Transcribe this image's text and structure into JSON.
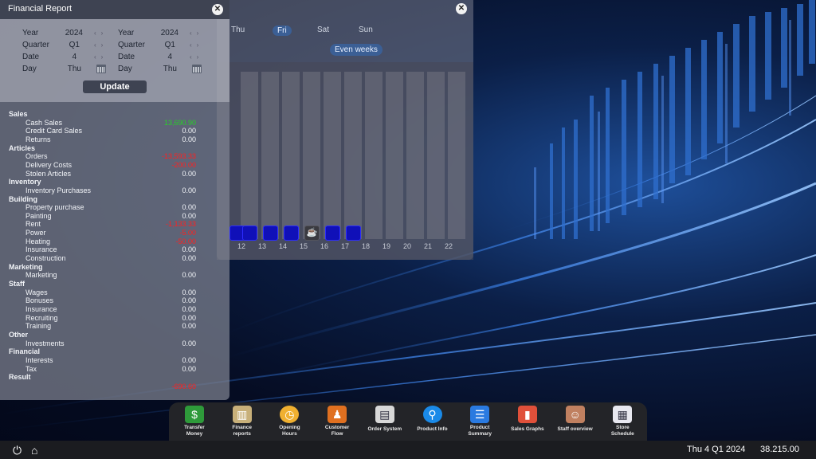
{
  "week_schedule": {
    "days": [
      "Thu",
      "Fri",
      "Sat",
      "Sun"
    ],
    "selected_day": "Fri",
    "even_weeks_label": "Even weeks",
    "close_icon": "close-icon",
    "hours": [
      "12",
      "13",
      "14",
      "15",
      "16",
      "17",
      "18",
      "19",
      "20",
      "21",
      "22"
    ]
  },
  "financial_report": {
    "title": "Financial Report",
    "close_icon": "close-icon",
    "filters_left": {
      "year_label": "Year",
      "year_value": "2024",
      "quarter_label": "Quarter",
      "quarter_value": "Q1",
      "date_label": "Date",
      "date_value": "4",
      "day_label": "Day",
      "day_value": "Thu"
    },
    "filters_right": {
      "year_label": "Year",
      "year_value": "2024",
      "quarter_label": "Quarter",
      "quarter_value": "Q1",
      "date_label": "Date",
      "date_value": "4",
      "day_label": "Day",
      "day_value": "Thu"
    },
    "update_label": "Update",
    "sections": [
      {
        "category": "Sales",
        "items": [
          {
            "label": "Cash Sales",
            "value": "13,690.90",
            "color": "green"
          },
          {
            "label": "Credit Card Sales",
            "value": "0.00",
            "color": "white"
          },
          {
            "label": "Returns",
            "value": "0.00",
            "color": "white"
          }
        ]
      },
      {
        "category": "Articles",
        "items": [
          {
            "label": "Orders",
            "value": "-13,593.33",
            "color": "red"
          },
          {
            "label": "Delivery Costs",
            "value": "-200.00",
            "color": "red"
          },
          {
            "label": "Stolen Articles",
            "value": "0.00",
            "color": "white"
          }
        ]
      },
      {
        "category": "Inventory",
        "items": [
          {
            "label": "Inventory Purchases",
            "value": "0.00",
            "color": "white"
          }
        ]
      },
      {
        "category": "Building",
        "items": [
          {
            "label": "Property purchase",
            "value": "0.00",
            "color": "white"
          },
          {
            "label": "Painting",
            "value": "0.00",
            "color": "white"
          },
          {
            "label": "Rent",
            "value": "-1,133.33",
            "color": "red"
          },
          {
            "label": "Power",
            "value": "-5.00",
            "color": "red"
          },
          {
            "label": "Heating",
            "value": "-50.00",
            "color": "red"
          },
          {
            "label": "Insurance",
            "value": "0.00",
            "color": "white"
          },
          {
            "label": "Construction",
            "value": "0.00",
            "color": "white"
          }
        ]
      },
      {
        "category": "Marketing",
        "items": [
          {
            "label": "Marketing",
            "value": "0.00",
            "color": "white"
          }
        ]
      },
      {
        "category": "Staff",
        "items": [
          {
            "label": "Wages",
            "value": "0.00",
            "color": "white"
          },
          {
            "label": "Bonuses",
            "value": "0.00",
            "color": "white"
          },
          {
            "label": "Insurance",
            "value": "0.00",
            "color": "white"
          },
          {
            "label": "Recruiting",
            "value": "0.00",
            "color": "white"
          },
          {
            "label": "Training",
            "value": "0.00",
            "color": "white"
          }
        ]
      },
      {
        "category": "Other",
        "items": [
          {
            "label": "Investments",
            "value": "0.00",
            "color": "white"
          }
        ]
      },
      {
        "category": "Financial",
        "items": [
          {
            "label": "Interests",
            "value": "0.00",
            "color": "white"
          },
          {
            "label": "Tax",
            "value": "0.00",
            "color": "white"
          }
        ]
      }
    ],
    "result_label": "Result",
    "result_value": "-690.60",
    "result_color": "red"
  },
  "dock": [
    {
      "label_1": "Transfer",
      "label_2": "Money",
      "icon": "money-transfer-icon",
      "color": "#2e9a3a"
    },
    {
      "label_1": "Finance",
      "label_2": "reports",
      "icon": "finance-chart-icon",
      "color": "#c8b07a"
    },
    {
      "label_1": "Opening",
      "label_2": "Hours",
      "icon": "clock-icon",
      "color": "#f0b030"
    },
    {
      "label_1": "Customer",
      "label_2": "Flow",
      "icon": "customer-flow-icon",
      "color": "#e07020"
    },
    {
      "label_1": "Order System",
      "label_2": "",
      "icon": "clipboard-icon",
      "color": "#d8d8d8"
    },
    {
      "label_1": "Product Info",
      "label_2": "",
      "icon": "product-search-icon",
      "color": "#1a8ae8"
    },
    {
      "label_1": "Product",
      "label_2": "Summary",
      "icon": "list-icon",
      "color": "#2a7ae0"
    },
    {
      "label_1": "Sales Graphs",
      "label_2": "",
      "icon": "bar-graph-icon",
      "color": "#e0503a"
    },
    {
      "label_1": "Staff overview",
      "label_2": "",
      "icon": "staff-icon",
      "color": "#c08060"
    },
    {
      "label_1": "Store",
      "label_2": "Schedule",
      "icon": "calendar-icon",
      "color": "#e8e8f0"
    }
  ],
  "status": {
    "power_icon": "power-icon",
    "home_icon": "home-icon",
    "date": "Thu 4 Q1 2024",
    "money": "38.215.00"
  }
}
